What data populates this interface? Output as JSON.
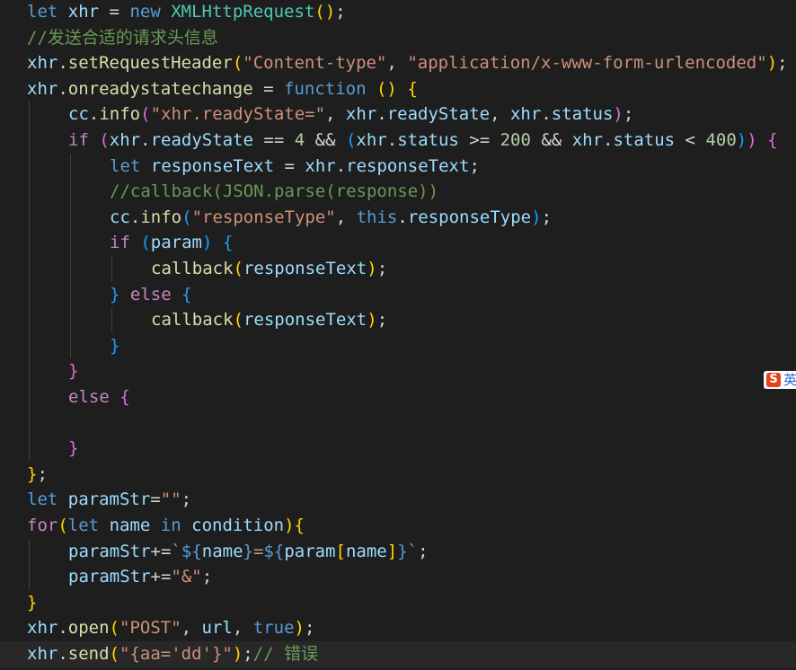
{
  "colors": {
    "background": "#1e1e1e",
    "current_line": "#282828",
    "keyword": "#569cd6",
    "control": "#c586c0",
    "variable": "#9cdcfe",
    "function": "#dcdcaa",
    "class": "#4ec9b0",
    "string": "#ce9178",
    "number": "#b5cea8",
    "comment": "#6a9955",
    "plain": "#d4d4d4",
    "bracket1": "#ffd700",
    "bracket2": "#da70d6",
    "bracket3": "#179fff",
    "guide": "#404040"
  },
  "ime_indicator": {
    "icon": "sogou-s-icon",
    "badge": "S",
    "label": "英"
  },
  "code_lines": [
    {
      "indent": 0,
      "tokens": [
        [
          "let",
          "keyword"
        ],
        [
          " ",
          "plain"
        ],
        [
          "xhr",
          "variable"
        ],
        [
          " = ",
          "plain"
        ],
        [
          "new",
          "keyword"
        ],
        [
          " ",
          "plain"
        ],
        [
          "XMLHttpRequest",
          "class"
        ],
        [
          "()",
          "bracket1"
        ],
        [
          ";",
          "plain"
        ]
      ]
    },
    {
      "indent": 0,
      "tokens": [
        [
          "//发送合适的请求头信息",
          "comment"
        ]
      ]
    },
    {
      "indent": 0,
      "tokens": [
        [
          "xhr",
          "variable"
        ],
        [
          ".",
          "plain"
        ],
        [
          "setRequestHeader",
          "function"
        ],
        [
          "(",
          "bracket1"
        ],
        [
          "\"Content-type\"",
          "string"
        ],
        [
          ", ",
          "plain"
        ],
        [
          "\"application/x-www-form-urlencoded\"",
          "string"
        ],
        [
          ")",
          "bracket1"
        ],
        [
          ";",
          "plain"
        ]
      ]
    },
    {
      "indent": 0,
      "tokens": [
        [
          "xhr",
          "variable"
        ],
        [
          ".",
          "plain"
        ],
        [
          "onreadystatechange",
          "function"
        ],
        [
          " = ",
          "plain"
        ],
        [
          "function",
          "keyword"
        ],
        [
          " ",
          "plain"
        ],
        [
          "()",
          "bracket1"
        ],
        [
          " ",
          "plain"
        ],
        [
          "{",
          "bracket1"
        ]
      ]
    },
    {
      "indent": 1,
      "tokens": [
        [
          "cc",
          "variable"
        ],
        [
          ".",
          "plain"
        ],
        [
          "info",
          "function"
        ],
        [
          "(",
          "bracket2"
        ],
        [
          "\"xhr.readyState=\"",
          "string"
        ],
        [
          ", ",
          "plain"
        ],
        [
          "xhr",
          "variable"
        ],
        [
          ".",
          "plain"
        ],
        [
          "readyState",
          "variable"
        ],
        [
          ", ",
          "plain"
        ],
        [
          "xhr",
          "variable"
        ],
        [
          ".",
          "plain"
        ],
        [
          "status",
          "variable"
        ],
        [
          ")",
          "bracket2"
        ],
        [
          ";",
          "plain"
        ]
      ]
    },
    {
      "indent": 1,
      "tokens": [
        [
          "if",
          "control"
        ],
        [
          " ",
          "plain"
        ],
        [
          "(",
          "bracket2"
        ],
        [
          "xhr",
          "variable"
        ],
        [
          ".",
          "plain"
        ],
        [
          "readyState",
          "variable"
        ],
        [
          " == ",
          "plain"
        ],
        [
          "4",
          "number"
        ],
        [
          " && ",
          "plain"
        ],
        [
          "(",
          "bracket3"
        ],
        [
          "xhr",
          "variable"
        ],
        [
          ".",
          "plain"
        ],
        [
          "status",
          "variable"
        ],
        [
          " >= ",
          "plain"
        ],
        [
          "200",
          "number"
        ],
        [
          " && ",
          "plain"
        ],
        [
          "xhr",
          "variable"
        ],
        [
          ".",
          "plain"
        ],
        [
          "status",
          "variable"
        ],
        [
          " < ",
          "plain"
        ],
        [
          "400",
          "number"
        ],
        [
          ")",
          "bracket3"
        ],
        [
          ")",
          "bracket2"
        ],
        [
          " ",
          "plain"
        ],
        [
          "{",
          "bracket2"
        ]
      ]
    },
    {
      "indent": 2,
      "tokens": [
        [
          "let",
          "keyword"
        ],
        [
          " ",
          "plain"
        ],
        [
          "responseText",
          "variable"
        ],
        [
          " = ",
          "plain"
        ],
        [
          "xhr",
          "variable"
        ],
        [
          ".",
          "plain"
        ],
        [
          "responseText",
          "variable"
        ],
        [
          ";",
          "plain"
        ]
      ]
    },
    {
      "indent": 2,
      "tokens": [
        [
          "//callback(JSON.parse(response))",
          "comment"
        ]
      ]
    },
    {
      "indent": 2,
      "tokens": [
        [
          "cc",
          "variable"
        ],
        [
          ".",
          "plain"
        ],
        [
          "info",
          "function"
        ],
        [
          "(",
          "bracket3"
        ],
        [
          "\"responseType\"",
          "string"
        ],
        [
          ", ",
          "plain"
        ],
        [
          "this",
          "keyword"
        ],
        [
          ".",
          "plain"
        ],
        [
          "responseType",
          "variable"
        ],
        [
          ")",
          "bracket3"
        ],
        [
          ";",
          "plain"
        ]
      ]
    },
    {
      "indent": 2,
      "tokens": [
        [
          "if",
          "control"
        ],
        [
          " ",
          "plain"
        ],
        [
          "(",
          "bracket3"
        ],
        [
          "param",
          "variable"
        ],
        [
          ")",
          "bracket3"
        ],
        [
          " ",
          "plain"
        ],
        [
          "{",
          "bracket3"
        ]
      ]
    },
    {
      "indent": 3,
      "tokens": [
        [
          "callback",
          "function"
        ],
        [
          "(",
          "bracket1"
        ],
        [
          "responseText",
          "variable"
        ],
        [
          ")",
          "bracket1"
        ],
        [
          ";",
          "plain"
        ]
      ]
    },
    {
      "indent": 2,
      "tokens": [
        [
          "}",
          "bracket3"
        ],
        [
          " ",
          "plain"
        ],
        [
          "else",
          "control"
        ],
        [
          " ",
          "plain"
        ],
        [
          "{",
          "bracket3"
        ]
      ]
    },
    {
      "indent": 3,
      "tokens": [
        [
          "callback",
          "function"
        ],
        [
          "(",
          "bracket1"
        ],
        [
          "responseText",
          "variable"
        ],
        [
          ")",
          "bracket1"
        ],
        [
          ";",
          "plain"
        ]
      ]
    },
    {
      "indent": 2,
      "tokens": [
        [
          "}",
          "bracket3"
        ]
      ]
    },
    {
      "indent": 1,
      "tokens": [
        [
          "}",
          "bracket2"
        ]
      ]
    },
    {
      "indent": 1,
      "tokens": [
        [
          "else",
          "control"
        ],
        [
          " ",
          "plain"
        ],
        [
          "{",
          "bracket2"
        ]
      ]
    },
    {
      "indent": 0,
      "tokens": []
    },
    {
      "indent": 1,
      "tokens": [
        [
          "}",
          "bracket2"
        ]
      ]
    },
    {
      "indent": 0,
      "tokens": [
        [
          "}",
          "bracket1"
        ],
        [
          ";",
          "plain"
        ]
      ]
    },
    {
      "indent": 0,
      "tokens": [
        [
          "let",
          "keyword"
        ],
        [
          " ",
          "plain"
        ],
        [
          "paramStr",
          "variable"
        ],
        [
          "=",
          "plain"
        ],
        [
          "\"\"",
          "string"
        ],
        [
          ";",
          "plain"
        ]
      ]
    },
    {
      "indent": 0,
      "tokens": [
        [
          "for",
          "control"
        ],
        [
          "(",
          "bracket1"
        ],
        [
          "let",
          "keyword"
        ],
        [
          " ",
          "plain"
        ],
        [
          "name",
          "variable"
        ],
        [
          " ",
          "plain"
        ],
        [
          "in",
          "keyword"
        ],
        [
          " ",
          "plain"
        ],
        [
          "condition",
          "variable"
        ],
        [
          ")",
          "bracket1"
        ],
        [
          "{",
          "bracket1"
        ]
      ]
    },
    {
      "indent": 1,
      "tokens": [
        [
          "paramStr",
          "variable"
        ],
        [
          "+=",
          "plain"
        ],
        [
          "`",
          "string"
        ],
        [
          "${",
          "keyword"
        ],
        [
          "name",
          "variable"
        ],
        [
          "}",
          "keyword"
        ],
        [
          "=",
          "string"
        ],
        [
          "${",
          "keyword"
        ],
        [
          "param",
          "variable"
        ],
        [
          "[",
          "bracket1"
        ],
        [
          "name",
          "variable"
        ],
        [
          "]",
          "bracket1"
        ],
        [
          "}",
          "keyword"
        ],
        [
          "`",
          "string"
        ],
        [
          ";",
          "plain"
        ]
      ]
    },
    {
      "indent": 1,
      "tokens": [
        [
          "paramStr",
          "variable"
        ],
        [
          "+=",
          "plain"
        ],
        [
          "\"&\"",
          "string"
        ],
        [
          ";",
          "plain"
        ]
      ]
    },
    {
      "indent": 0,
      "tokens": [
        [
          "}",
          "bracket1"
        ]
      ]
    },
    {
      "indent": 0,
      "tokens": [
        [
          "xhr",
          "variable"
        ],
        [
          ".",
          "plain"
        ],
        [
          "open",
          "function"
        ],
        [
          "(",
          "bracket1"
        ],
        [
          "\"POST\"",
          "string"
        ],
        [
          ", ",
          "plain"
        ],
        [
          "url",
          "variable"
        ],
        [
          ", ",
          "plain"
        ],
        [
          "true",
          "keyword"
        ],
        [
          ")",
          "bracket1"
        ],
        [
          ";",
          "plain"
        ]
      ]
    },
    {
      "indent": 0,
      "tokens": [
        [
          "xhr",
          "variable"
        ],
        [
          ".",
          "plain"
        ],
        [
          "send",
          "function"
        ],
        [
          "(",
          "bracket1"
        ],
        [
          "\"{aa='dd'}\"",
          "string"
        ],
        [
          ")",
          "bracket1"
        ],
        [
          ";",
          "plain"
        ],
        [
          "// 错误",
          "comment"
        ]
      ]
    }
  ],
  "current_line_index": 25,
  "indent_guides": [
    {
      "level": 1,
      "from": 4,
      "to": 17
    },
    {
      "level": 2,
      "from": 6,
      "to": 13
    },
    {
      "level": 3,
      "from": 10,
      "to": 10
    },
    {
      "level": 3,
      "from": 12,
      "to": 12
    },
    {
      "level": 1,
      "from": 21,
      "to": 22
    }
  ]
}
